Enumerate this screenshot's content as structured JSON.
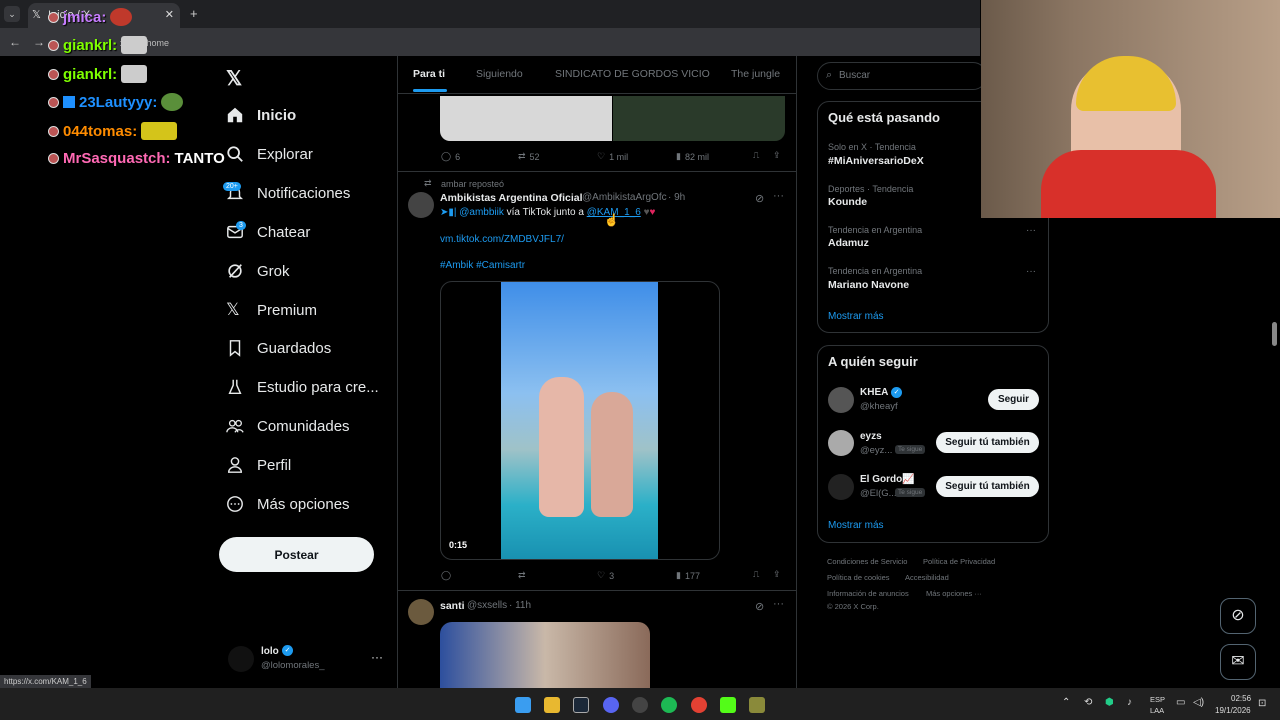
{
  "browser": {
    "tab_title": "Inicio / X",
    "url_partial": "x.com/home",
    "status_url": "https://x.com/KAM_1_6"
  },
  "chat": [
    {
      "user": "jmica:",
      "color": "#c77dff"
    },
    {
      "user": "giankrl:",
      "color": "#7fff00"
    },
    {
      "user": "giankrl:",
      "color": "#7fff00"
    },
    {
      "user": "23Lautyyy:",
      "color": "#1e90ff"
    },
    {
      "user": "044tomas:",
      "color": "#ff8c00"
    },
    {
      "user": "MrSasquastch:",
      "color": "#ff69b4",
      "message": "TANTO"
    }
  ],
  "nav": {
    "home": "Inicio",
    "explore": "Explorar",
    "notifications": "Notificaciones",
    "notifications_badge": "20+",
    "chat": "Chatear",
    "chat_badge": "3",
    "grok": "Grok",
    "premium": "Premium",
    "bookmarks": "Guardados",
    "studio": "Estudio para cre...",
    "communities": "Comunidades",
    "profile": "Perfil",
    "more": "Más opciones",
    "post_button": "Postear"
  },
  "account": {
    "name": "lolo",
    "handle": "@lolomorales_"
  },
  "feed_tabs": [
    "Para ti",
    "Siguiendo",
    "SINDICATO DE GORDOS VICIO",
    "The jungle"
  ],
  "post0": {
    "replies": "6",
    "reposts": "52",
    "likes": "1 mil",
    "views": "82 mil"
  },
  "post1": {
    "repost_line": "ambar reposteó",
    "name": "Ambikistas Argentina Oficial",
    "handle": "@AmbikistaArgOfc",
    "time": "· 9h",
    "text_mention": "@ambbiik",
    "text_mid": "vía TikTok junto a",
    "text_mention2": "@KAM_1_6",
    "link": "vm.tiktok.com/ZMDBVJFL7/",
    "hashtags": "#Ambik #Camisartr",
    "video_time": "0:15",
    "replies": "",
    "reposts": "",
    "likes": "3",
    "views": "177"
  },
  "post2": {
    "name": "santi",
    "handle": "@sxsells",
    "time": "· 11h"
  },
  "search": {
    "placeholder": "Buscar"
  },
  "trends": {
    "title": "Qué está pasando",
    "items": [
      {
        "meta": "Solo en X · Tendencia",
        "name": "#MiAniversarioDeX"
      },
      {
        "meta": "Deportes · Tendencia",
        "name": "Kounde"
      },
      {
        "meta": "Tendencia en Argentina",
        "name": "Adamuz"
      },
      {
        "meta": "Tendencia en Argentina",
        "name": "Mariano Navone"
      }
    ],
    "show_more": "Mostrar más"
  },
  "who_to_follow": {
    "title": "A quién seguir",
    "items": [
      {
        "name": "KHEA",
        "handle": "@kheayf",
        "button": "Seguir"
      },
      {
        "name": "eyzs",
        "handle": "@eyz...",
        "badge": "Te sigue",
        "button": "Seguir tú también"
      },
      {
        "name": "El Gordo📈",
        "handle": "@El(G...",
        "badge": "Te sigue",
        "button": "Seguir tú también"
      }
    ],
    "show_more": "Mostrar más"
  },
  "footer": {
    "l1a": "Condiciones de Servicio",
    "l1b": "Política de Privacidad",
    "l2a": "Política de cookies",
    "l2b": "Accesibilidad",
    "l3a": "Información de anuncios",
    "l3b": "Más opciones ···",
    "l4": "© 2026 X Corp."
  },
  "taskbar": {
    "lang1": "ESP",
    "lang2": "LAA",
    "time": "02:56",
    "date": "19/1/2026"
  },
  "colors": {
    "accent": "#1d9bf0",
    "bg": "#000000",
    "border": "#2f3336"
  }
}
